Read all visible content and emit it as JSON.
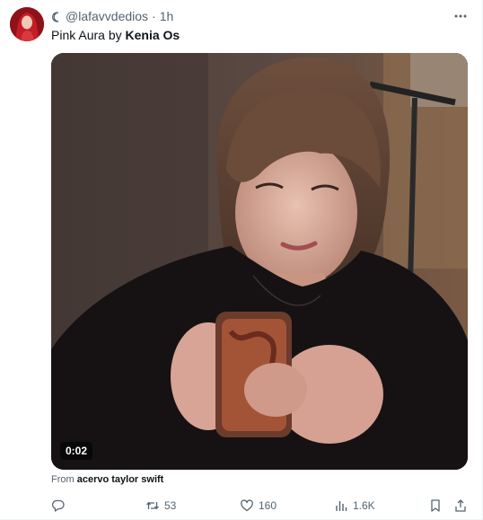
{
  "tweet": {
    "handle": "@lafavvdedios",
    "time": "1h",
    "separator": "·",
    "text_prefix": "Pink Aura by ",
    "text_bold": "Kenia Os",
    "media": {
      "duration": "0:02",
      "source_prefix": "From ",
      "source_name": "acervo taylor swift"
    }
  },
  "actions": {
    "reply_count": "",
    "retweet_count": "53",
    "like_count": "160",
    "views_count": "1.6K"
  },
  "icons": {
    "handle_prefix": "moon-icon",
    "more": "more-icon",
    "reply": "reply-icon",
    "retweet": "retweet-icon",
    "like": "heart-icon",
    "views": "views-icon",
    "bookmark": "bookmark-icon",
    "share": "share-icon"
  },
  "colors": {
    "text_primary": "#0f1419",
    "text_secondary": "#536471",
    "border": "#eff3f4"
  }
}
